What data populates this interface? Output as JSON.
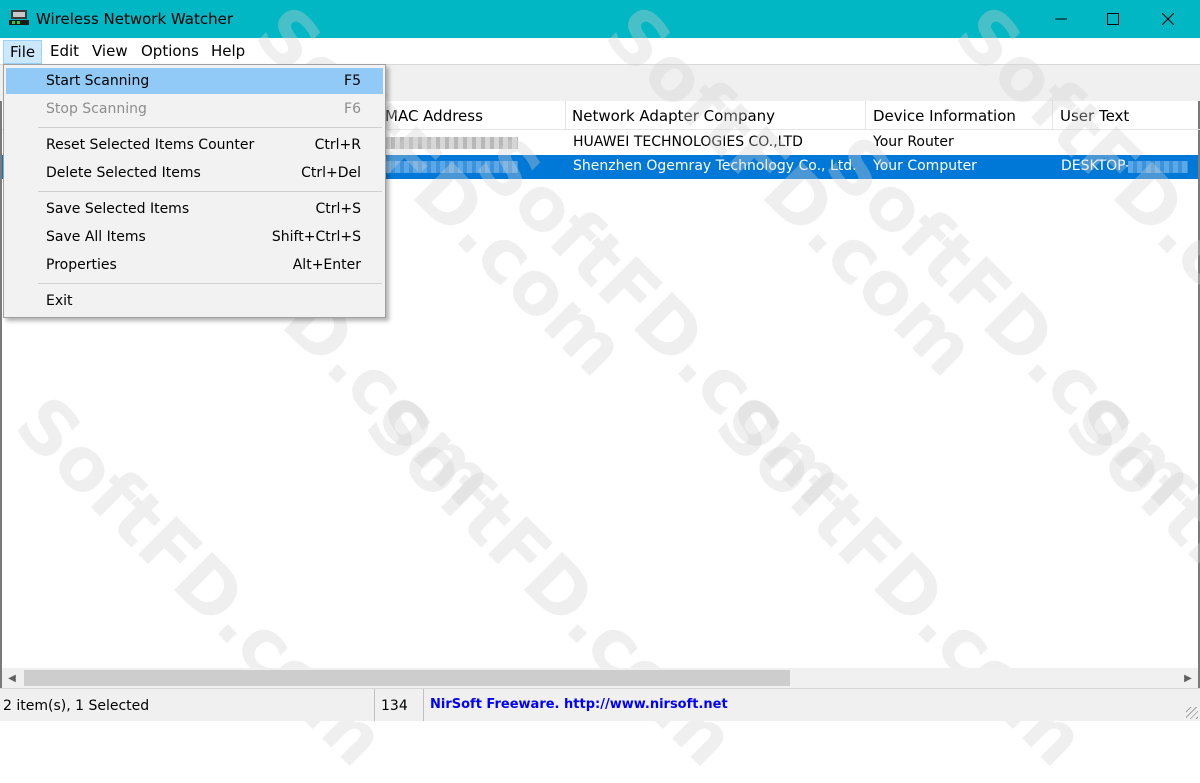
{
  "window": {
    "title": "Wireless Network Watcher"
  },
  "menubar": {
    "items": [
      "File",
      "Edit",
      "View",
      "Options",
      "Help"
    ]
  },
  "columns": [
    "MAC Address",
    "Network Adapter Company",
    "Device Information",
    "User Text"
  ],
  "rows": [
    {
      "company": "HUAWEI TECHNOLOGIES CO.,LTD",
      "device": "Your Router",
      "user_text": ""
    },
    {
      "company": "Shenzhen Ogemray Technology Co., Ltd.",
      "device": "Your Computer",
      "user_text": "DESKTOP-"
    }
  ],
  "file_menu": {
    "items": [
      {
        "label": "Start Scanning",
        "key": "F5"
      },
      {
        "label": "Stop Scanning",
        "key": "F6"
      },
      {
        "label": "Reset Selected Items Counter",
        "key": "Ctrl+R"
      },
      {
        "label": "Delete Selected Items",
        "key": "Ctrl+Del"
      },
      {
        "label": "Save Selected Items",
        "key": "Ctrl+S"
      },
      {
        "label": "Save All Items",
        "key": "Shift+Ctrl+S"
      },
      {
        "label": "Properties",
        "key": "Alt+Enter"
      },
      {
        "label": "Exit",
        "key": ""
      }
    ]
  },
  "status": {
    "items_text": "2 item(s), 1 Selected",
    "count": "134",
    "freeware": "NirSoft Freeware.  http://www.nirsoft.net"
  },
  "watermark": "SoftFD.com",
  "colors": {
    "titlebar": "#00b7c3",
    "selection": "#0078d7",
    "menu_highlight": "#91c9f7"
  }
}
